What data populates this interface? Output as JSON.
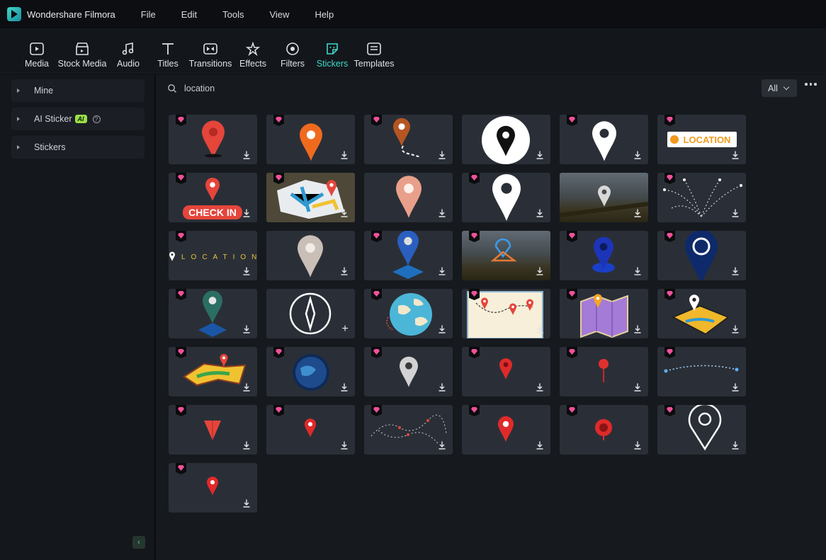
{
  "app": {
    "title": "Wondershare Filmora"
  },
  "menu": [
    "File",
    "Edit",
    "Tools",
    "View",
    "Help"
  ],
  "toolbar": [
    {
      "label": "Media",
      "icon": "media-icon"
    },
    {
      "label": "Stock Media",
      "icon": "stock-media-icon"
    },
    {
      "label": "Audio",
      "icon": "audio-icon"
    },
    {
      "label": "Titles",
      "icon": "titles-icon"
    },
    {
      "label": "Transitions",
      "icon": "transitions-icon"
    },
    {
      "label": "Effects",
      "icon": "effects-icon"
    },
    {
      "label": "Filters",
      "icon": "filters-icon"
    },
    {
      "label": "Stickers",
      "icon": "stickers-icon",
      "active": true
    },
    {
      "label": "Templates",
      "icon": "templates-icon"
    }
  ],
  "sidebar": {
    "items": [
      {
        "label": "Mine"
      },
      {
        "label": "AI Sticker",
        "badge": "AI"
      },
      {
        "label": "Stickers"
      }
    ]
  },
  "search": {
    "value": "location"
  },
  "filter": {
    "value": "All"
  },
  "colors": {
    "accent": "#3fd8c8",
    "premium": "#f0509a",
    "pin_red": "#e5453b",
    "pin_orange": "#f06a1e"
  },
  "stickers": [
    {
      "name": "red-pin",
      "premium": true,
      "action": "download"
    },
    {
      "name": "orange-pin",
      "premium": true,
      "action": "download"
    },
    {
      "name": "pin-dotted-trail",
      "premium": true,
      "action": "download"
    },
    {
      "name": "black-pin-white-circle",
      "premium": false,
      "action": "download"
    },
    {
      "name": "white-pin",
      "premium": true,
      "action": "download"
    },
    {
      "name": "location-banner",
      "premium": true,
      "action": "download",
      "text": "LOCATION"
    },
    {
      "name": "check-in",
      "premium": true,
      "action": "download",
      "text": "CHECK IN"
    },
    {
      "name": "3d-map",
      "premium": true,
      "action": "download"
    },
    {
      "name": "fuzzy-pin",
      "premium": false,
      "action": "download"
    },
    {
      "name": "white-pin-large",
      "premium": true,
      "action": "download"
    },
    {
      "name": "pin-over-vineyard",
      "premium": false,
      "action": "download"
    },
    {
      "name": "dotted-routes",
      "premium": true,
      "action": "download"
    },
    {
      "name": "location-text-line",
      "premium": true,
      "action": "download",
      "text": "LOCATION"
    },
    {
      "name": "grey-fuzzy-pin",
      "premium": false,
      "action": "download"
    },
    {
      "name": "blue-3d-pin",
      "premium": true,
      "action": "download"
    },
    {
      "name": "pin-vineyard-outline",
      "premium": true,
      "action": "download"
    },
    {
      "name": "blue-pin-ripple",
      "premium": true,
      "action": "download"
    },
    {
      "name": "navy-ring-pin",
      "premium": true,
      "action": "download"
    },
    {
      "name": "teal-3d-pin",
      "premium": true,
      "action": "download"
    },
    {
      "name": "compass-arrow",
      "premium": false,
      "action": "add"
    },
    {
      "name": "globe-pins",
      "premium": true,
      "action": "download"
    },
    {
      "name": "paper-map-route",
      "premium": true,
      "action": "download"
    },
    {
      "name": "purple-folded-map",
      "premium": true,
      "action": "download"
    },
    {
      "name": "treasure-map-pin",
      "premium": true,
      "action": "download"
    },
    {
      "name": "colorful-map",
      "premium": true,
      "action": "download"
    },
    {
      "name": "earth-glow",
      "premium": true,
      "action": "download"
    },
    {
      "name": "grey-pin",
      "premium": true,
      "action": "download"
    },
    {
      "name": "small-red-pin",
      "premium": true,
      "action": "download"
    },
    {
      "name": "push-pin",
      "premium": true,
      "action": "download"
    },
    {
      "name": "dotted-arc",
      "premium": true,
      "action": "download"
    },
    {
      "name": "red-arrow-cursor",
      "premium": true,
      "action": "download"
    },
    {
      "name": "tiny-red-pin",
      "premium": true,
      "action": "download"
    },
    {
      "name": "dotted-network",
      "premium": true,
      "action": "download"
    },
    {
      "name": "red-pin-white-center",
      "premium": true,
      "action": "download"
    },
    {
      "name": "round-red-pin",
      "premium": true,
      "action": "download"
    },
    {
      "name": "sketch-pin",
      "premium": true,
      "action": "download"
    },
    {
      "name": "red-pin-small",
      "premium": true,
      "action": "download"
    }
  ]
}
